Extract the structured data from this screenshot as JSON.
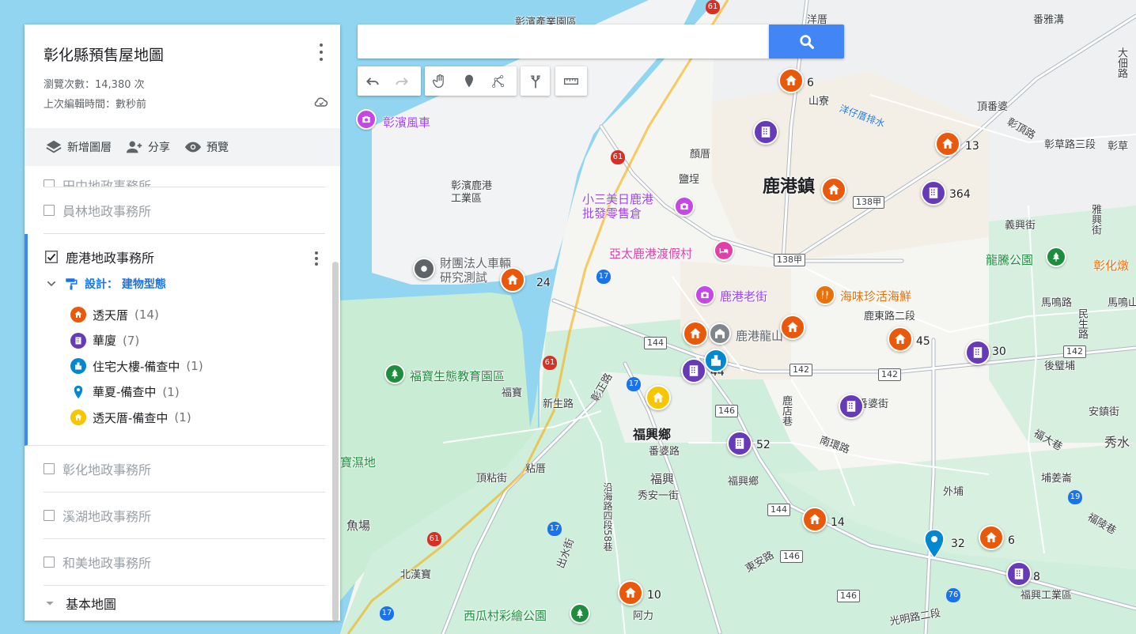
{
  "search": {
    "placeholder": "",
    "value": ""
  },
  "toolbar": {
    "undo": "undo-icon",
    "redo": "redo-icon",
    "hand": "hand-icon",
    "marker": "marker-icon",
    "line": "draw-line-icon",
    "directions": "directions-icon",
    "measure": "ruler-icon"
  },
  "panel": {
    "title": "彰化縣預售屋地圖",
    "view_count": "瀏覽次數：14,380 次",
    "last_edit": "上次編輯時間：數秒前",
    "actions": {
      "add_layer": "新增圖層",
      "share": "分享",
      "preview": "預覽"
    },
    "layers": {
      "partial": "田中地政事務所",
      "yuanlin": "員林地政事務所",
      "lukang": "鹿港地政事務所",
      "style_label": "設計：  建物型態",
      "legend": [
        {
          "label": "透天厝",
          "count": "(14)",
          "color": "#e8590c",
          "icon": "house-icon"
        },
        {
          "label": "華廈",
          "count": "(7)",
          "color": "#673ab7",
          "icon": "building-icon"
        },
        {
          "label": "住宅大樓-備查中",
          "count": "(1)",
          "color": "#0288d1",
          "icon": "tower-icon"
        },
        {
          "label": "華夏-備查中",
          "count": "(1)",
          "color": "#0288d1",
          "icon": "pin-icon"
        },
        {
          "label": "透天厝-備查中",
          "count": "(1)",
          "color": "#f7c600",
          "icon": "house-icon"
        }
      ],
      "changhua": "彰化地政事務所",
      "xihu": "溪湖地政事務所",
      "hemei": "和美地政事務所",
      "basemap": "基本地圖"
    }
  },
  "map": {
    "labels": {
      "industrial": "彰濱產業園區",
      "yangcuo": "洋厝",
      "fanyagou": "番雅溝",
      "shanzhai": "山寮",
      "yangzi": "洋仔厝排水",
      "dingpoliao": "頂番婆",
      "zhangding": "彰頂路",
      "zhangcao3": "彰草路三段",
      "zhangcao": "彰草",
      "windmill": "彰濱風車",
      "lu_gang_town": "鹿港鎮",
      "jiancuo": "顏厝",
      "yancuo": "鹽埕",
      "zhangbin_lukang": "彰濱鹿港\n工業區",
      "xiaosan": "小三美日鹿港\n批發零售倉",
      "yata": "亞太鹿港渡假村",
      "caituan": "財團法人車輛\n研究測試",
      "lukang_old": "鹿港老街",
      "seafood": "海味珍活海鮮",
      "longshan": "鹿港龍山",
      "lukang_dong": "鹿東路二段",
      "fubao_park": "福寶生態教育園區",
      "fubao": "福寶",
      "xinsheng": "新生路",
      "fuxing_town": "福興鄉",
      "fuxing": "福興",
      "fanpo": "番婆街",
      "nanhuan": "南環路",
      "fuxing_xiang": "福興鄉",
      "xiuan": "秀安一街",
      "dingnian": "頂粘街",
      "nianxcuo": "粘厝",
      "wetland": "寶濕地",
      "fishfield": "魚場",
      "beihan": "北漢寶",
      "xigua": "西瓜村彩繪公園",
      "ali": "阿力",
      "guangming": "光明路二段",
      "fuxing_ind": "福興工業區",
      "longteng": "龍騰公園",
      "zhanghuadun": "彰化燉",
      "mamingroad": "馬鳴路",
      "mamingshan": "馬鳴山",
      "houxing": "後璧埔",
      "anjing": "安鎮街",
      "fuda": "福大巷",
      "xiushui": "秀水",
      "puxiao": "埔姜崙",
      "waipu": "外埔",
      "fuxingroad": "福陵巷",
      "yixing": "義興街",
      "datiao": "大佃路",
      "minsheng": "民生路",
      "yaxing": "雅興街",
      "lushiyuan": "鹿店巷",
      "changzheng": "彰正路",
      "yanhai": "沿海路四段58巷",
      "chushui": "出水街",
      "sizhe": "番婆路",
      "dong": "東安路"
    },
    "shields": [
      "61",
      "61",
      "17",
      "138甲",
      "138甲",
      "144",
      "146",
      "142",
      "142",
      "142",
      "144",
      "146",
      "146",
      "76",
      "19",
      "61",
      "17",
      "17",
      "17",
      "61"
    ],
    "markers": [
      {
        "type": "house",
        "color": "orange",
        "count": "6"
      },
      {
        "type": "house",
        "color": "orange",
        "count": "13"
      },
      {
        "type": "building",
        "color": "purple",
        "count": "364"
      },
      {
        "type": "house",
        "color": "orange",
        "count": ""
      },
      {
        "type": "building",
        "color": "purple",
        "count": ""
      },
      {
        "type": "house",
        "color": "orange",
        "count": "24"
      },
      {
        "type": "house",
        "color": "orange",
        "count": "45"
      },
      {
        "type": "house",
        "color": "orange",
        "count": ""
      },
      {
        "type": "building",
        "color": "purple",
        "count": "30"
      },
      {
        "type": "house",
        "color": "orange",
        "count": ""
      },
      {
        "type": "building",
        "color": "purple",
        "count": "44"
      },
      {
        "type": "tower",
        "color": "blue",
        "count": ""
      },
      {
        "type": "house",
        "color": "yellow",
        "count": ""
      },
      {
        "type": "building",
        "color": "purple",
        "count": ""
      },
      {
        "type": "building",
        "color": "purple",
        "count": "52"
      },
      {
        "type": "house",
        "color": "orange",
        "count": "14"
      },
      {
        "type": "house",
        "color": "orange",
        "count": "6"
      },
      {
        "type": "pin",
        "color": "blue",
        "count": "32"
      },
      {
        "type": "building",
        "color": "purple",
        "count": "8"
      },
      {
        "type": "house",
        "color": "orange",
        "count": "10"
      }
    ]
  },
  "colors": {
    "water": "#91d5f0",
    "land": "#f8f9fa",
    "green": "#c9ecd4",
    "accent": "#4285f4"
  }
}
